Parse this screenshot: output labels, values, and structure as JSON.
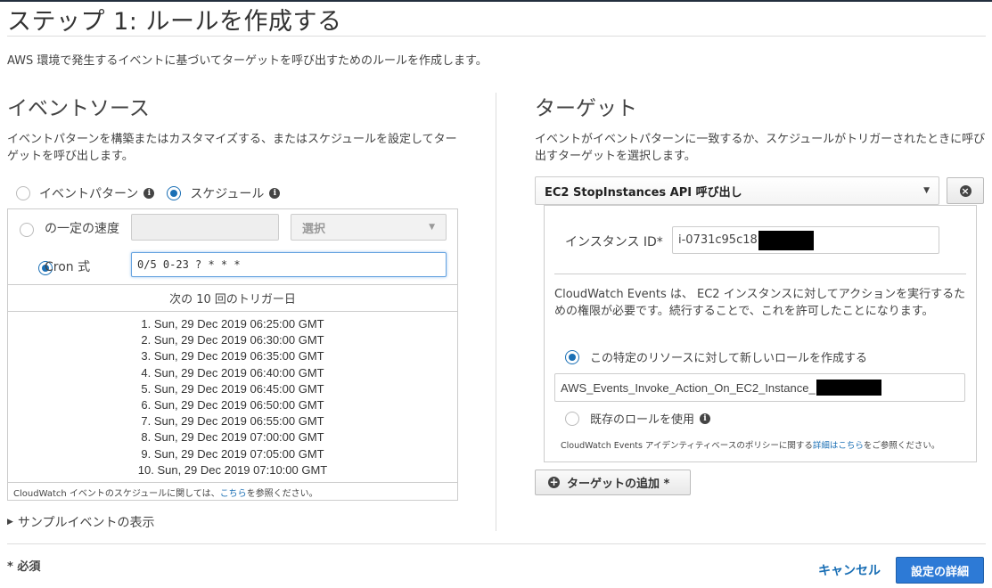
{
  "page": {
    "title": "ステップ 1: ルールを作成する",
    "subtitle": "AWS 環境で発生するイベントに基づいてターゲットを呼び出すためのルールを作成します。"
  },
  "event_source": {
    "title": "イベントソース",
    "description": "イベントパターンを構築またはカスタマイズする、またはスケジュールを設定してターゲットを呼び出します。",
    "radio_event_pattern": "イベントパターン",
    "radio_schedule": "スケジュール",
    "fixed_rate_label": "の一定の速度",
    "fixed_rate_value": "",
    "select_placeholder": "選択",
    "cron_label": "Cron 式",
    "cron_value": "0/5 0-23 ? * * *",
    "next_triggers_header": "次の 10 回のトリガー日",
    "triggers": [
      "1. Sun, 29 Dec 2019 06:25:00 GMT",
      "2. Sun, 29 Dec 2019 06:30:00 GMT",
      "3. Sun, 29 Dec 2019 06:35:00 GMT",
      "4. Sun, 29 Dec 2019 06:40:00 GMT",
      "5. Sun, 29 Dec 2019 06:45:00 GMT",
      "6. Sun, 29 Dec 2019 06:50:00 GMT",
      "7. Sun, 29 Dec 2019 06:55:00 GMT",
      "8. Sun, 29 Dec 2019 07:00:00 GMT",
      "9. Sun, 29 Dec 2019 07:05:00 GMT",
      "10. Sun, 29 Dec 2019 07:10:00 GMT"
    ],
    "footnote_prefix": "CloudWatch イベントのスケジュールに関しては、",
    "footnote_link": "こちら",
    "footnote_suffix": "を参照ください。",
    "sample_event": "サンプルイベントの表示"
  },
  "target": {
    "title": "ターゲット",
    "description": "イベントがイベントパターンに一致するか、スケジュールがトリガーされたときに呼び出すターゲットを選択します。",
    "selected_target": "EC2 StopInstances API 呼び出し",
    "instance_label": "インスタンス ID*",
    "instance_value": "i-0731c95c18",
    "permission_text": "CloudWatch Events は、 EC2 インスタンスに対してアクションを実行するための権限が必要です。続行することで、これを許可したことになります。",
    "radio_new_role": "この特定のリソースに対して新しいロールを作成する",
    "role_name_value": "AWS_Events_Invoke_Action_On_EC2_Instance_",
    "radio_existing_role": "既存のロールを使用",
    "policy_prefix": "CloudWatch Events アイデンティティベースのポリシーに関する",
    "policy_link": "詳細はこちら",
    "policy_suffix": "をご参照ください。",
    "add_target": "ターゲットの追加 *"
  },
  "footer": {
    "required": "* 必須",
    "cancel": "キャンセル",
    "configure": "設定の詳細"
  },
  "colors": {
    "accent": "#1a6fb5",
    "primary_button": "#2d7ad6"
  }
}
